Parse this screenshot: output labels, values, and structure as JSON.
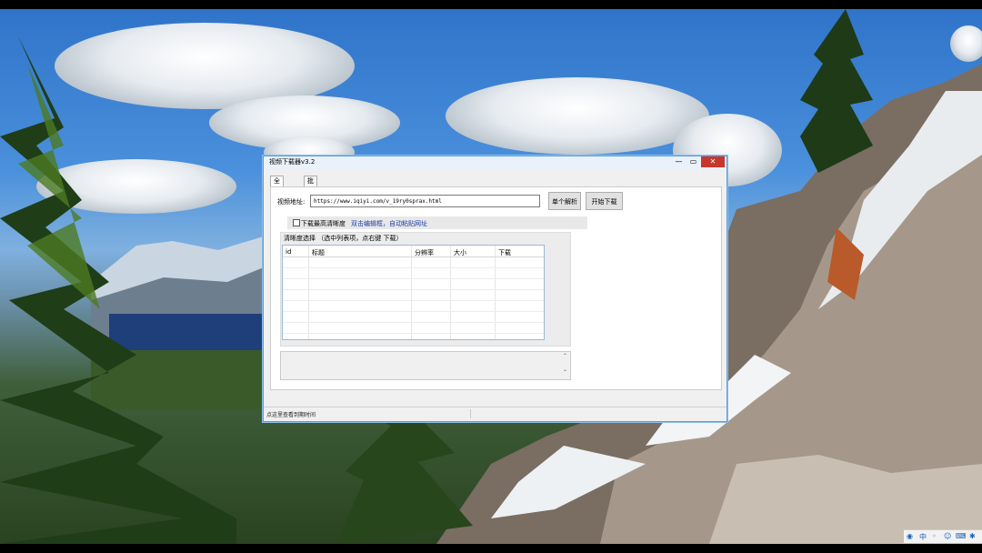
{
  "window": {
    "title": "视频下载器v3.2",
    "minimize_glyph": "—",
    "maximize_glyph": "▭",
    "close_glyph": "✕"
  },
  "tabs": [
    {
      "label": "全能解析",
      "active": true
    },
    {
      "label": "批量下载",
      "active": false
    }
  ],
  "form": {
    "url_label": "视频地址:",
    "url_value": "https://www.iqiyi.com/v_19ry0sprax.html",
    "single_parse_button": "单个解析",
    "start_download_button": "开始下载",
    "hd_checkbox_label": "下载最高清晰度",
    "hd_checked": false,
    "hint_link": "双击编辑框，自动粘贴网址"
  },
  "quality": {
    "group_label": "清晰度选择  （选中列表项，点右键 下载）",
    "columns": [
      "id",
      "标题",
      "分辨率",
      "大小",
      "下载"
    ]
  },
  "log": {
    "scroll_up_glyph": "⌃",
    "scroll_down_glyph": "⌄"
  },
  "statusbar": {
    "text": "点这里查看到期时间"
  },
  "tray": {
    "icons": [
      "search-icon",
      "ime-icon",
      "punctuation-icon",
      "emoji-icon",
      "keyboard-icon",
      "settings-icon"
    ]
  },
  "colors": {
    "close_button": "#c7372c",
    "window_border": "#5b9bd5",
    "link": "#1a3da8"
  }
}
